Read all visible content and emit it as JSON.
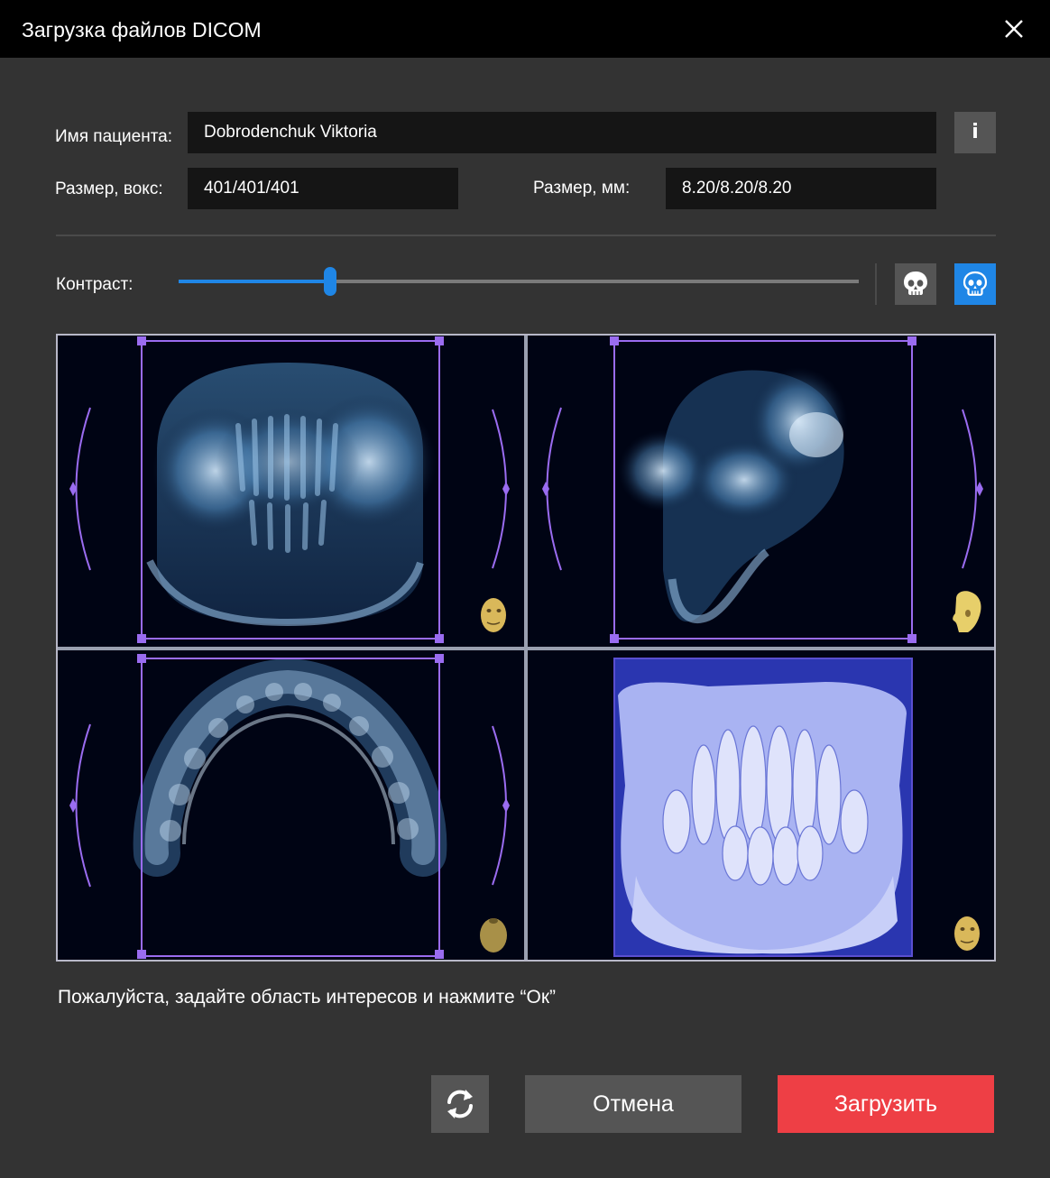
{
  "window": {
    "title": "Загрузка файлов DICOM"
  },
  "patient": {
    "name_label": "Имя пациента:",
    "name_value": "Dobrodenchuk Viktoria",
    "info_label": "i"
  },
  "size": {
    "voxel_label": "Размер, вокс:",
    "voxel_value": "401/401/401",
    "mm_label": "Размер, мм:",
    "mm_value": "8.20/8.20/8.20"
  },
  "contrast": {
    "label": "Контраст:",
    "value_fraction": 0.223
  },
  "colors": {
    "accent": "#1f86e6",
    "primary_button": "#ee3f45",
    "roi": "#9a6cf0",
    "render_3d": "#2a36b0"
  },
  "views": [
    {
      "name": "frontal-view",
      "orientation_icon": "head-front-icon"
    },
    {
      "name": "lateral-view",
      "orientation_icon": "head-side-icon"
    },
    {
      "name": "axial-view",
      "orientation_icon": "head-top-icon"
    },
    {
      "name": "render-3d-view",
      "orientation_icon": "head-front-icon"
    }
  ],
  "message": "Пожалуйста, задайте область интересов и нажмите “Ок”",
  "buttons": {
    "cancel": "Отмена",
    "load": "Загрузить"
  }
}
